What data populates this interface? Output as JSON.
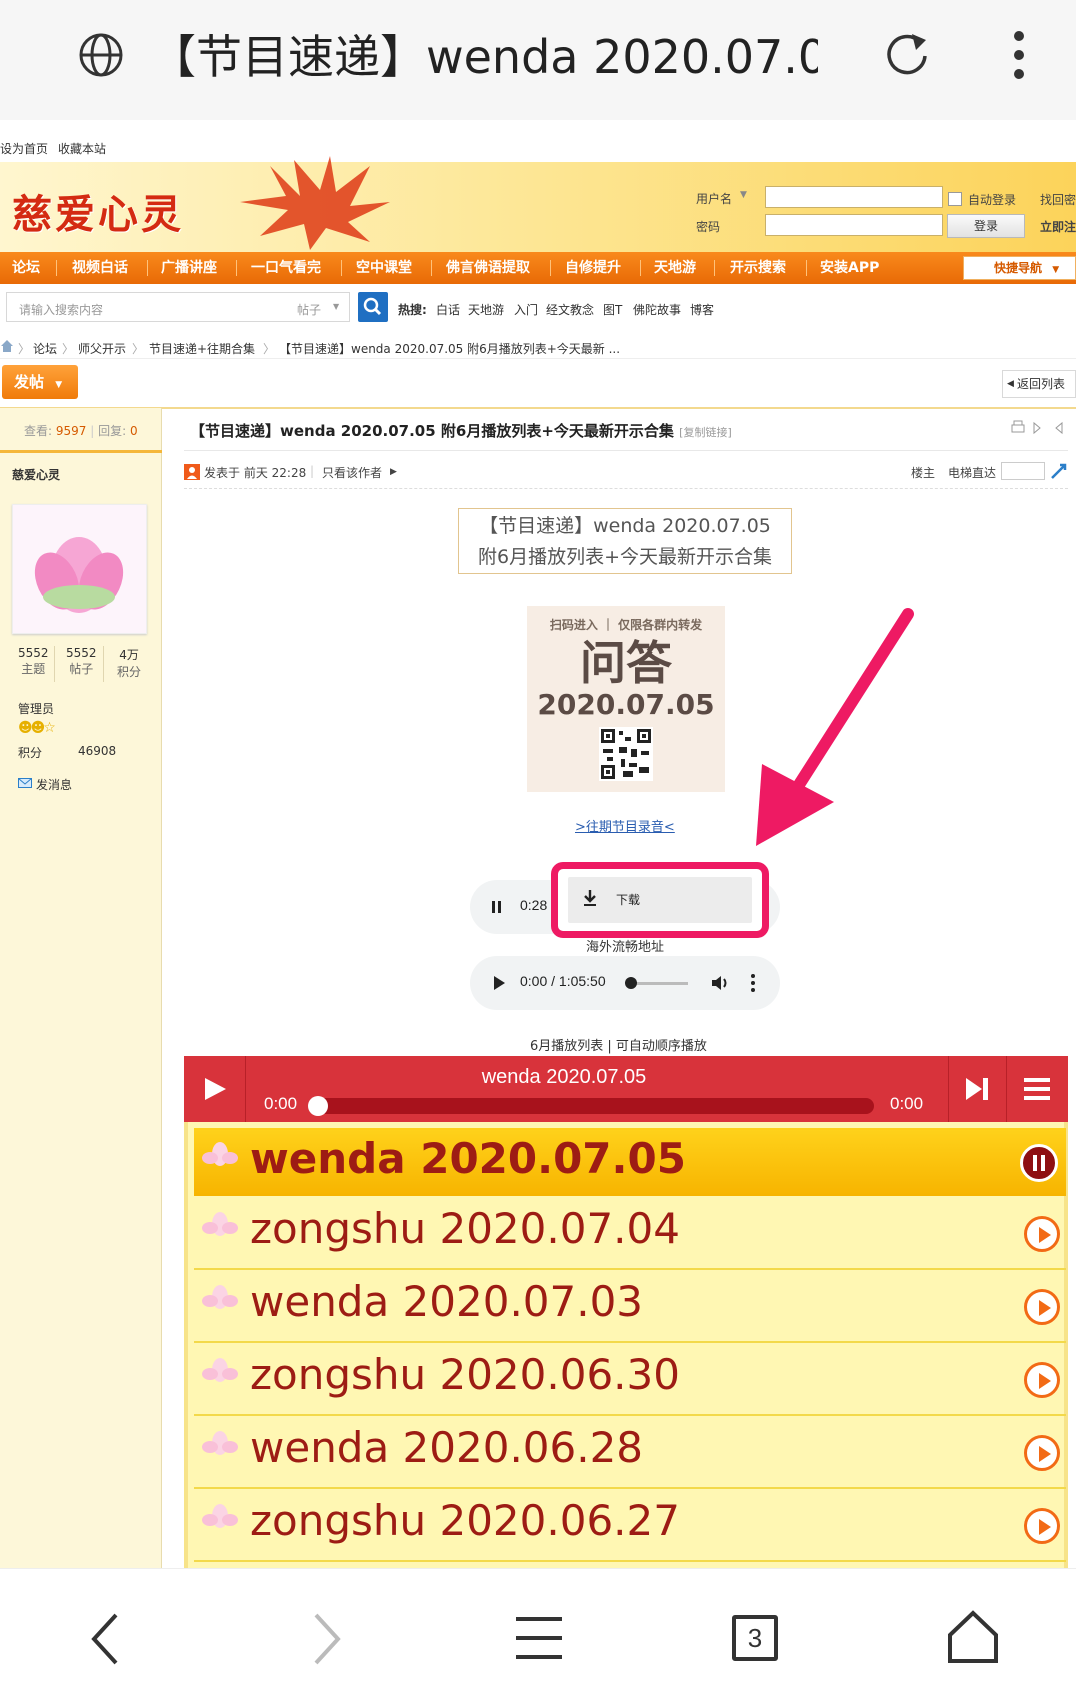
{
  "browser": {
    "title": "【节目速递】wenda 2020.07.05 附6月播放列表+今天最新开示合集",
    "tab_count": "3"
  },
  "sitebar": {
    "set_home": "设为首页",
    "bookmark": "收藏本站"
  },
  "header": {
    "logo": "慈爱心灵",
    "username_label": "用户名",
    "password_label": "密码",
    "auto_login": "自动登录",
    "find_password": "找回密",
    "login_button": "登录",
    "register": "立即注"
  },
  "nav": {
    "items": [
      "论坛",
      "视频白话",
      "广播讲座",
      "一口气看完",
      "空中课堂",
      "佛言佛语提取",
      "自修提升",
      "天地游",
      "开示搜索",
      "安装APP"
    ],
    "quick_nav": "快捷导航"
  },
  "search": {
    "placeholder": "请输入搜索内容",
    "type": "帖子",
    "hot_label": "热搜:",
    "hot_words": [
      "白话",
      "天地游",
      "入门",
      "经文教念",
      "图T",
      "佛陀故事",
      "博客"
    ]
  },
  "breadcrumb": [
    "论坛",
    "师父开示",
    "节目速递+往期合集",
    "【节目速递】wenda 2020.07.05 附6月播放列表+今天最新 ..."
  ],
  "post_button": "发帖",
  "back_list": "返回列表",
  "sidebar": {
    "views_label": "查看:",
    "views": "9597",
    "replies_label": "回复:",
    "replies": "0",
    "author": "慈爱心灵",
    "stats": [
      {
        "value": "5552",
        "label": "主题"
      },
      {
        "value": "5552",
        "label": "帖子"
      },
      {
        "value": "4万",
        "label": "积分"
      }
    ],
    "role": "管理员",
    "points_label": "积分",
    "points": "46908",
    "message": "发消息"
  },
  "post": {
    "title": "【节目速递】wenda 2020.07.05 附6月播放列表+今天最新开示合集",
    "copy_link": "[复制链接]",
    "posted": "发表于 前天 22:28",
    "only_author": "只看该作者",
    "floor": "楼主",
    "elevator": "电梯直达",
    "box_line1": "【节目速递】wenda 2020.07.05",
    "box_line2": "附6月播放列表+今天最新开示合集",
    "qr_top": "扫码进入 ｜ 仅限各群内转发",
    "qr_big": "问答",
    "qr_date": "2020.07.05",
    "past_link": ">往期节目录音<",
    "audio1_time": "0:28",
    "download": "下载",
    "overseas": "海外流畅地址",
    "audio2_time": "0:00 / 1:05:50",
    "playlist_caption": "6月播放列表 | 可自动顺序播放"
  },
  "player": {
    "now_title": "wenda 2020.07.05",
    "elapsed": "0:00",
    "duration": "0:00",
    "items": [
      "wenda 2020.07.05",
      "zongshu 2020.07.04",
      "wenda 2020.07.03",
      "zongshu 2020.06.30",
      "wenda 2020.06.28",
      "zongshu 2020.06.27"
    ]
  },
  "colors": {
    "accent": "#f07b0a",
    "player": "#d8333b",
    "annotation": "#ee1a63"
  }
}
